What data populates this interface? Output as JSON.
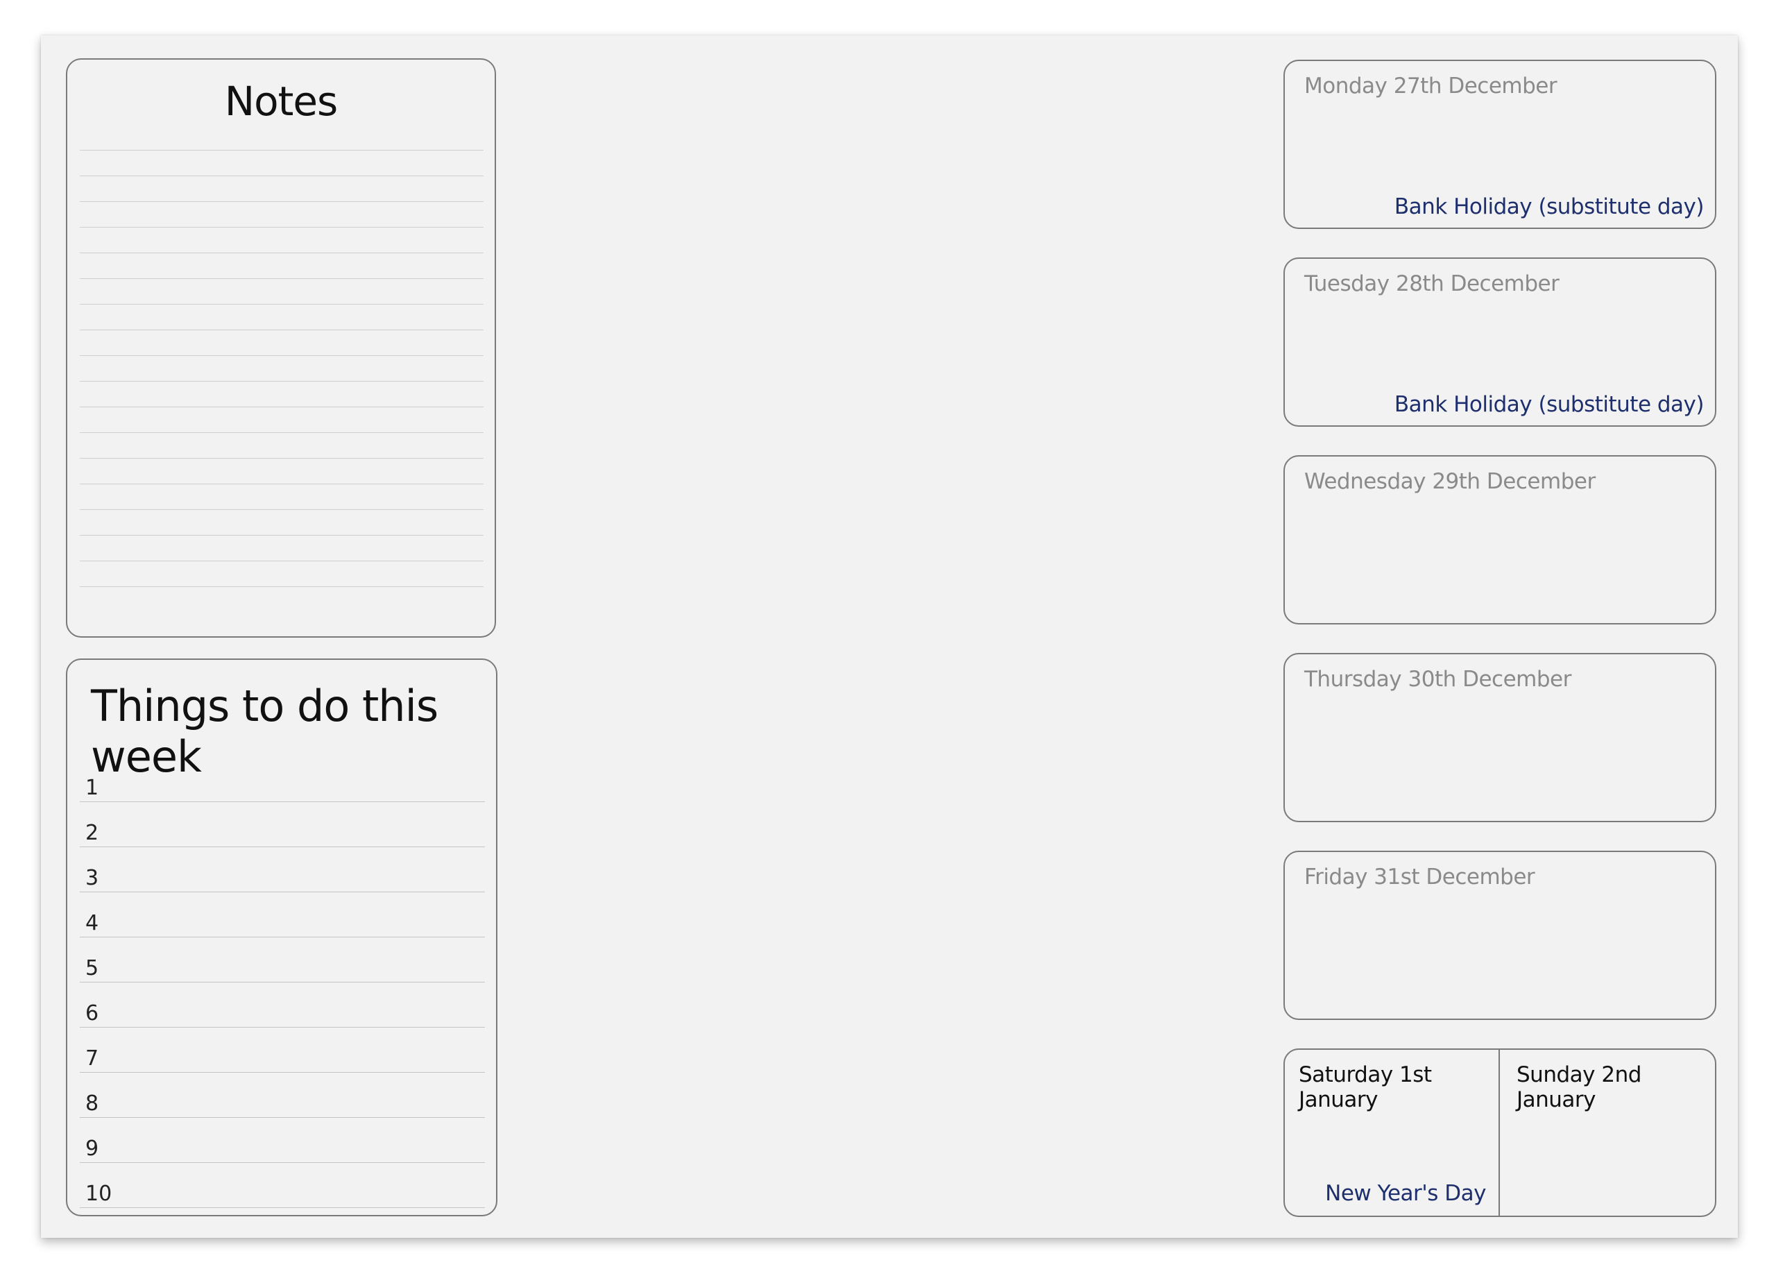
{
  "notes": {
    "title": "Notes"
  },
  "todo": {
    "title": "Things to do this week",
    "items": [
      "1",
      "2",
      "3",
      "4",
      "5",
      "6",
      "7",
      "8",
      "9",
      "10"
    ]
  },
  "days": [
    {
      "label": "Monday 27th December",
      "holiday": "Bank Holiday (substitute day)"
    },
    {
      "label": "Tuesday 28th December",
      "holiday": "Bank Holiday (substitute day)"
    },
    {
      "label": "Wednesday 29th December",
      "holiday": ""
    },
    {
      "label": "Thursday 30th December",
      "holiday": ""
    },
    {
      "label": "Friday 31st December",
      "holiday": ""
    }
  ],
  "weekend": {
    "saturday": {
      "label": "Saturday 1st January",
      "holiday": "New Year's Day"
    },
    "sunday": {
      "label": "Sunday 2nd January",
      "holiday": ""
    }
  },
  "colors": {
    "sheet": "#f2f2f2",
    "border": "#7a7a7a",
    "day_label": "#8a8a8a",
    "holiday": "#1e2f6e"
  }
}
